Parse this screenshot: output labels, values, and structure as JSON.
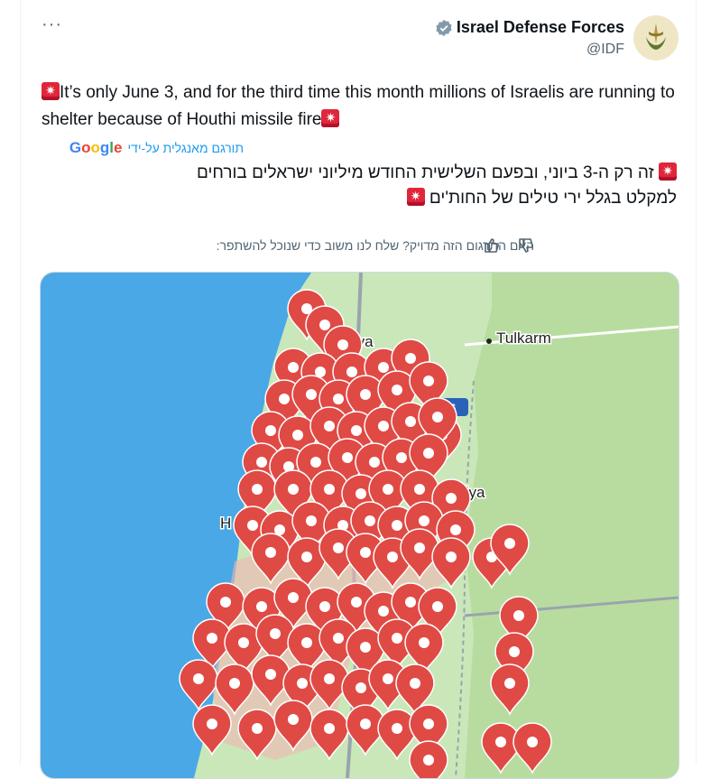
{
  "author": {
    "name": "Israel Defense Forces",
    "handle": "@IDF"
  },
  "menu": {
    "more_label": "···"
  },
  "tweet": {
    "text_en": "It’s only June 3, and for the third time this month millions of Israelis are running to shelter because of Houthi missile fire",
    "translated_by": "תורגם מאנגלית על-ידי",
    "translator": "Google",
    "text_he_line1": "זה רק ה-3 ביוני, ובפעם השלישית החודש מיליוני ישראלים בורחים",
    "text_he_line2": "למקלט בגלל ירי טילים של החות'ים",
    "translation_feedback": "האם התרגום הזה מדויק? שלח לנו משוב כדי שנוכל להשתפר:"
  },
  "map": {
    "labels": {
      "netanya": "tanya",
      "tulkarm": "Tulkarm",
      "qalqiliya": "lqiliya",
      "herzliya": "H",
      "route": "6"
    },
    "colors": {
      "sea": "#4aa8e6",
      "land": "#c9e7b8",
      "pin": "#e04a45"
    }
  }
}
